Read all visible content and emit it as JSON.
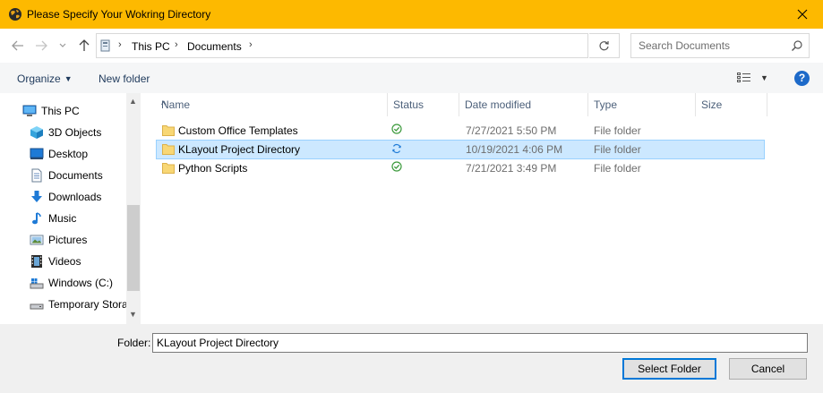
{
  "window": {
    "title": "Please Specify Your Wokring Directory",
    "close_glyph": "✕"
  },
  "nav": {
    "back_glyph": "←",
    "forward_glyph": "→",
    "recent_glyph": "⌄",
    "up_glyph": "↑"
  },
  "address": {
    "sep": "›",
    "crumbs": [
      "This PC",
      "Documents"
    ],
    "refresh_glyph": "↻"
  },
  "search": {
    "placeholder": "Search Documents"
  },
  "toolbar": {
    "organize": "Organize",
    "new_folder": "New folder",
    "caret": "▼",
    "help": "?"
  },
  "sidebar": {
    "items": [
      {
        "label": "This PC",
        "icon": "computer-icon"
      },
      {
        "label": "3D Objects",
        "icon": "cube-icon"
      },
      {
        "label": "Desktop",
        "icon": "desktop-icon"
      },
      {
        "label": "Documents",
        "icon": "documents-icon"
      },
      {
        "label": "Downloads",
        "icon": "download-arrow-icon"
      },
      {
        "label": "Music",
        "icon": "music-note-icon"
      },
      {
        "label": "Pictures",
        "icon": "pictures-icon"
      },
      {
        "label": "Videos",
        "icon": "film-icon"
      },
      {
        "label": "Windows (C:)",
        "icon": "drive-icon"
      },
      {
        "label": "Temporary Stora",
        "icon": "drive-icon"
      }
    ],
    "chevron": "›",
    "scroll_up": "▲",
    "scroll_down": "▼"
  },
  "columns": {
    "name": "Name",
    "status": "Status",
    "date_modified": "Date modified",
    "type": "Type",
    "size": "Size",
    "sort_glyph": "^"
  },
  "files": [
    {
      "name": "Custom Office Templates",
      "status": "synced",
      "date": "7/27/2021 5:50 PM",
      "type": "File folder",
      "selected": false
    },
    {
      "name": "KLayout Project Directory",
      "status": "syncing",
      "date": "10/19/2021 4:06 PM",
      "type": "File folder",
      "selected": true
    },
    {
      "name": "Python Scripts",
      "status": "synced",
      "date": "7/21/2021 3:49 PM",
      "type": "File folder",
      "selected": false
    }
  ],
  "footer": {
    "folder_label": "Folder:",
    "folder_value": "KLayout Project Directory",
    "select_button": "Select Folder",
    "cancel_button": "Cancel"
  },
  "colors": {
    "titlebar": "#fdb900",
    "selection": "#cce8ff",
    "accent": "#0078d7",
    "sync_ok": "#3c9a3c",
    "sync_pending": "#1e7ad6"
  }
}
